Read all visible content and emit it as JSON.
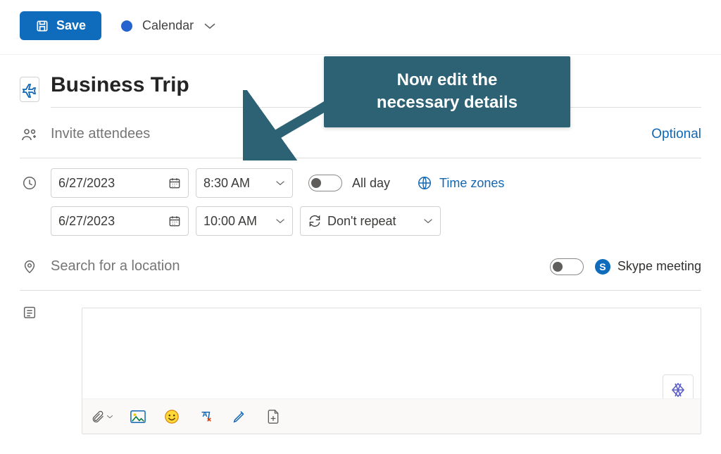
{
  "toolbar": {
    "save_label": "Save",
    "calendar_label": "Calendar"
  },
  "event": {
    "title": "Business Trip",
    "attendees_placeholder": "Invite attendees",
    "optional_label": "Optional",
    "start_date": "6/27/2023",
    "start_time": "8:30 AM",
    "end_date": "6/27/2023",
    "end_time": "10:00 AM",
    "all_day_label": "All day",
    "time_zones_label": "Time zones",
    "repeat_label": "Don't repeat",
    "location_placeholder": "Search for a location",
    "skype_label": "Skype meeting"
  },
  "callout": {
    "line1": "Now edit the",
    "line2": "necessary details"
  },
  "icons": {
    "category": "airplane-icon",
    "attendees": "people-icon",
    "time": "clock-icon",
    "location": "location-icon",
    "description": "notes-icon"
  }
}
